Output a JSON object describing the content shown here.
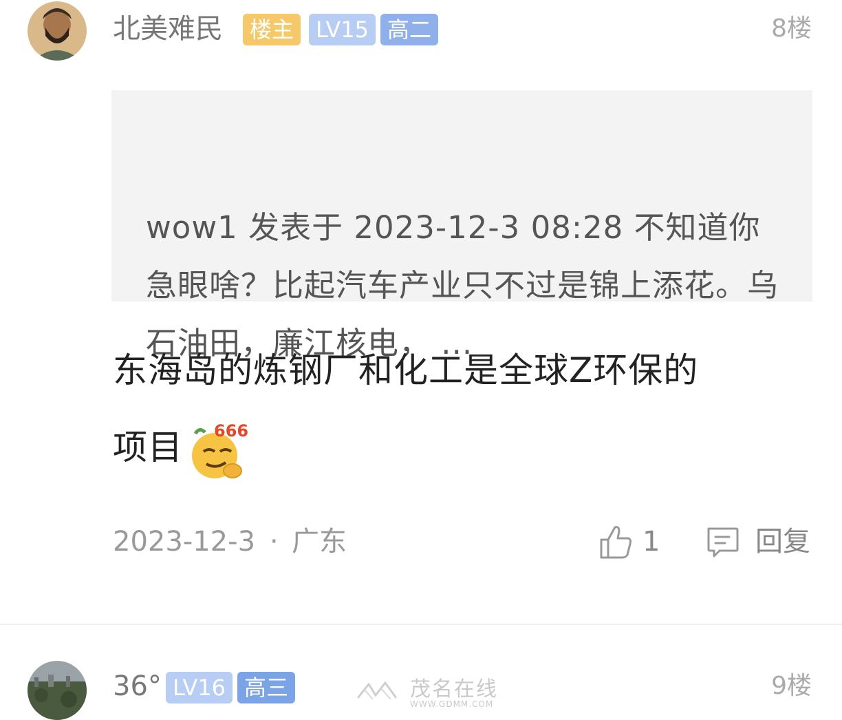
{
  "posts": [
    {
      "username": "北美难民",
      "badges": [
        {
          "label": "楼主",
          "color": "#f5c96a"
        },
        {
          "label": "LV15",
          "color": "#b7cdf3"
        },
        {
          "label": "高二",
          "color": "#8fb0ea"
        }
      ],
      "floor": "8楼",
      "quote": {
        "author": "wow1",
        "posted_at": "发表于 2023-12-3 08:28",
        "text": "wow1 发表于 2023-12-3 08:28 不知道你急眼啥？比起汽车产业只不过是锦上添花。乌石油田，廉江核电， ..."
      },
      "body_line1": "东海岛的炼钢厂和化工是全球Z环保的",
      "body_line2": "项目",
      "emoji": {
        "icon": "smirk-666-emoji",
        "caption": "666"
      },
      "date": "2023-12-3",
      "separator": "·",
      "location": "广东",
      "likes": "1",
      "reply_label": "回复"
    },
    {
      "username": "36°",
      "badges": [
        {
          "label": "LV16",
          "color": "#b7cdf3"
        },
        {
          "label": "高三",
          "color": "#7aa4e6"
        }
      ],
      "floor": "9楼"
    }
  ],
  "watermark": {
    "logo_text": "茂名在线",
    "url_text": "WWW.GDMM.COM"
  },
  "colors": {
    "quote_bg": "#f3f3f3",
    "muted_text": "#999999",
    "divider": "#eeeeee"
  }
}
